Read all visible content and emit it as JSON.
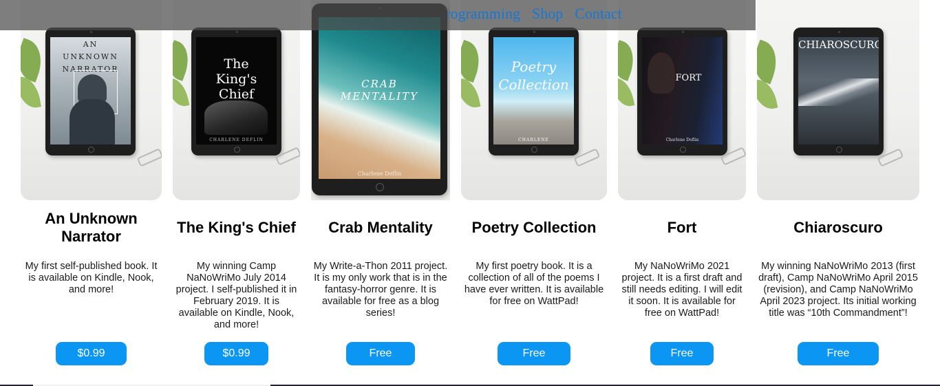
{
  "nav": {
    "items": [
      "Programming",
      "Shop",
      "Contact"
    ]
  },
  "books": [
    {
      "title": "An Unknown Narrator",
      "cover_title": "AN UNKNOWN NARRATOR",
      "cover_author": "",
      "description": "My first self-published book. It is available on Kindle, Nook, and more!",
      "price": "$0.99"
    },
    {
      "title": "The King's Chief",
      "cover_title": "The King's Chief",
      "cover_author": "CHARLENE DEFLIN",
      "description": "My winning Camp NaNoWriMo July 2014 project. I self-published it in February 2019. It is available on Kindle, Nook, and more!",
      "price": "$0.99"
    },
    {
      "title": "Crab Mentality",
      "cover_title": "CRAB MENTALITY",
      "cover_author": "Charlene Deflin",
      "description": "My Write-a-Thon 2011 project. It is my only work that is in the fantasy-horror genre. It is available for free as a blog series!",
      "price": "Free"
    },
    {
      "title": "Poetry Collection",
      "cover_title": "Poetry Collection",
      "cover_author": "CHARLENE",
      "description": "My first poetry book. It is a collection of all of the poems I have ever written. It is available for free on WattPad!",
      "price": "Free"
    },
    {
      "title": "Fort",
      "cover_title": "FORT",
      "cover_author": "Charlene Deflin",
      "description": "My NaNoWriMo 2021 project. It is a first draft and still needs editing. I will edit it soon. It is available for free on WattPad!",
      "price": "Free"
    },
    {
      "title": "Chiaroscuro",
      "cover_title": "CHIAROSCURO",
      "cover_author": "",
      "description": "My winning NaNoWriMo 2013 (first draft), Camp NaNoWriMo April 2015 (revision), and Camp NaNoWriMo April 2023 project. Its initial working title was “10th Commandment”!",
      "price": "Free"
    }
  ],
  "colors": {
    "accent": "#0a96f2",
    "nav_link": "#1577d6",
    "nav_bar": "#4c4c4c"
  }
}
